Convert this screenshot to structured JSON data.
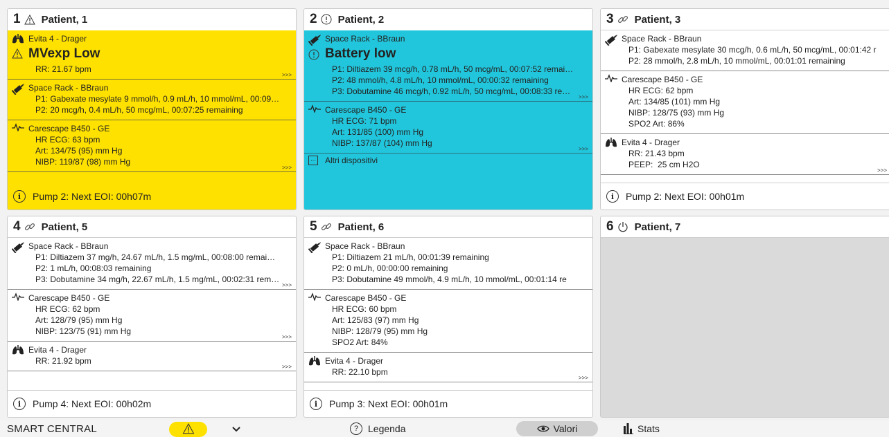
{
  "colors": {
    "alarm_yellow": "#ffe100",
    "alarm_cyan": "#22c6dc",
    "empty_gray": "#dadada"
  },
  "cards": [
    {
      "num": "1",
      "status_icon": "warning-triangle-icon",
      "title": "Patient, 1",
      "devices": [
        {
          "icon": "lungs-icon",
          "name": "Evita 4 - Drager",
          "alarm_icon": "warning-triangle-icon",
          "alarm": "MVexp Low",
          "lines": [
            "RR: 21.67 bpm"
          ],
          "more": ">>>"
        },
        {
          "icon": "syringe-icon",
          "name": "Space Rack - BBraun",
          "lines": [
            "P1: Gabexate mesylate 9 mmol/h, 0.9 mL/h, 10 mmol/mL, 00:09…",
            "P2: 20 mcg/h, 0.4 mL/h, 50 mcg/mL, 00:07:25 remaining"
          ]
        },
        {
          "icon": "ecg-wave-icon",
          "name": "Carescape B450 - GE",
          "lines": [
            "HR ECG: 63 bpm",
            "Art: 134/75 (95) mm Hg",
            "NIBP: 119/87 (98) mm Hg"
          ],
          "more": ">>>"
        }
      ],
      "footer": "Pump 2: Next EOI: 00h07m"
    },
    {
      "num": "2",
      "status_icon": "info-exclamation-icon",
      "title": "Patient, 2",
      "devices": [
        {
          "icon": "syringe-icon",
          "name": "Space Rack - BBraun",
          "alarm_icon": "info-exclamation-icon",
          "alarm": "Battery low",
          "lines": [
            "P1: Diltiazem 39 mcg/h, 0.78 mL/h, 50 mcg/mL, 00:07:52 remai…",
            "P2: 48 mmol/h, 4.8 mL/h, 10 mmol/mL, 00:00:32 remaining",
            "P3: Dobutamine 46 mcg/h, 0.92 mL/h, 50 mcg/mL, 00:08:33 re…"
          ],
          "more": ">>>"
        },
        {
          "icon": "ecg-wave-icon",
          "name": "Carescape B450 - GE",
          "lines": [
            "HR ECG: 71 bpm",
            "Art: 131/85 (100) mm Hg",
            "NIBP: 137/87 (104) mm Hg"
          ],
          "more": ">>>"
        }
      ],
      "other": "Altri dispositivi"
    },
    {
      "num": "3",
      "status_icon": "link-icon",
      "title": "Patient, 3",
      "devices": [
        {
          "icon": "syringe-icon",
          "name": "Space Rack - BBraun",
          "lines": [
            "P1: Gabexate mesylate 30 mcg/h, 0.6 mL/h, 50 mcg/mL, 00:01:42 r",
            "P2: 28 mmol/h, 2.8 mL/h, 10 mmol/mL, 00:01:01 remaining"
          ]
        },
        {
          "icon": "ecg-wave-icon",
          "name": "Carescape B450 - GE",
          "lines": [
            "HR ECG: 62 bpm",
            "Art: 134/85 (101) mm Hg",
            "NIBP: 128/75 (93) mm Hg",
            "SPO2 Art: 86%"
          ]
        },
        {
          "icon": "lungs-icon",
          "name": "Evita 4 - Drager",
          "lines": [
            "RR: 21.43 bpm",
            "PEEP:  25 cm H2O"
          ],
          "more": ">>>"
        }
      ],
      "footer": "Pump 2: Next EOI: 00h01m"
    },
    {
      "num": "4",
      "status_icon": "link-icon",
      "title": "Patient, 5",
      "devices": [
        {
          "icon": "syringe-icon",
          "name": "Space Rack - BBraun",
          "lines": [
            "P1: Diltiazem 37 mg/h, 24.67 mL/h, 1.5 mg/mL, 00:08:00 remai…",
            "P2: 1 mL/h, 00:08:03 remaining",
            "P3: Dobutamine 34 mg/h, 22.67 mL/h, 1.5 mg/mL, 00:02:31 rem…"
          ],
          "more": ">>>"
        },
        {
          "icon": "ecg-wave-icon",
          "name": "Carescape B450 - GE",
          "lines": [
            "HR ECG: 62 bpm",
            "Art: 128/79 (95) mm Hg",
            "NIBP: 123/75 (91) mm Hg"
          ],
          "more": ">>>"
        },
        {
          "icon": "lungs-icon",
          "name": "Evita 4 - Drager",
          "lines": [
            "RR: 21.92 bpm"
          ],
          "more": ">>>"
        }
      ],
      "footer": "Pump 4: Next EOI: 00h02m"
    },
    {
      "num": "5",
      "status_icon": "link-icon",
      "title": "Patient, 6",
      "devices": [
        {
          "icon": "syringe-icon",
          "name": "Space Rack - BBraun",
          "lines": [
            "P1: Diltiazem 21 mL/h, 00:01:39 remaining",
            "P2: 0 mL/h, 00:00:00 remaining",
            "P3: Dobutamine 49 mmol/h, 4.9 mL/h, 10 mmol/mL, 00:01:14 re"
          ]
        },
        {
          "icon": "ecg-wave-icon",
          "name": "Carescape B450 - GE",
          "lines": [
            "HR ECG: 60 bpm",
            "Art: 125/83 (97) mm Hg",
            "NIBP: 128/79 (95) mm Hg",
            "SPO2 Art: 84%"
          ]
        },
        {
          "icon": "lungs-icon",
          "name": "Evita 4 - Drager",
          "lines": [
            "RR: 22.10 bpm"
          ],
          "more": ">>>"
        }
      ],
      "footer": "Pump 3: Next EOI: 00h01m"
    },
    {
      "num": "6",
      "status_icon": "power-icon",
      "title": "Patient, 7",
      "devices": []
    }
  ],
  "bottombar": {
    "brand": "SMART CENTRAL",
    "warn_icon": "warning-triangle-icon",
    "chevron_icon": "chevron-down-icon",
    "legenda_icon": "question-circle-icon",
    "legenda": "Legenda",
    "valori_icon": "eye-icon",
    "valori": "Valori",
    "stats_icon": "bar-chart-icon",
    "stats": "Stats"
  }
}
